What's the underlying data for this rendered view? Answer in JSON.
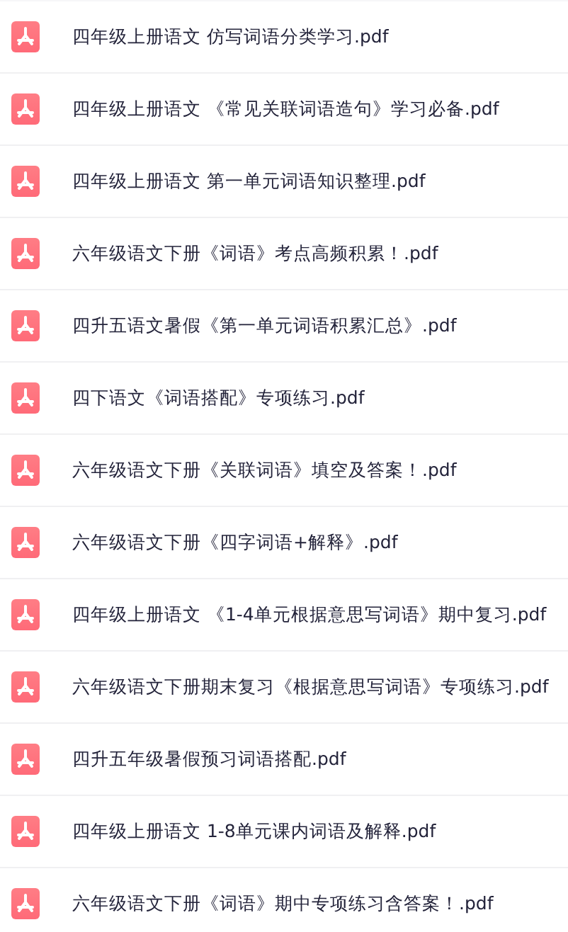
{
  "files": [
    {
      "name": "四年级上册语文 仿写词语分类学习.pdf"
    },
    {
      "name": "四年级上册语文 《常见关联词语造句》学习必备.pdf"
    },
    {
      "name": "四年级上册语文 第一单元词语知识整理.pdf"
    },
    {
      "name": "六年级语文下册《词语》考点高频积累！.pdf"
    },
    {
      "name": "四升五语文暑假《第一单元词语积累汇总》.pdf"
    },
    {
      "name": "四下语文《词语搭配》专项练习.pdf"
    },
    {
      "name": "六年级语文下册《关联词语》填空及答案！.pdf"
    },
    {
      "name": "六年级语文下册《四字词语+解释》.pdf"
    },
    {
      "name": "四年级上册语文 《1-4单元根据意思写词语》期中复习.pdf"
    },
    {
      "name": "六年级语文下册期末复习《根据意思写词语》专项练习.pdf"
    },
    {
      "name": "四升五年级暑假预习词语搭配.pdf"
    },
    {
      "name": "四年级上册语文 1-8单元课内词语及解释.pdf"
    },
    {
      "name": "六年级语文下册《词语》期中专项练习含答案！.pdf"
    }
  ]
}
